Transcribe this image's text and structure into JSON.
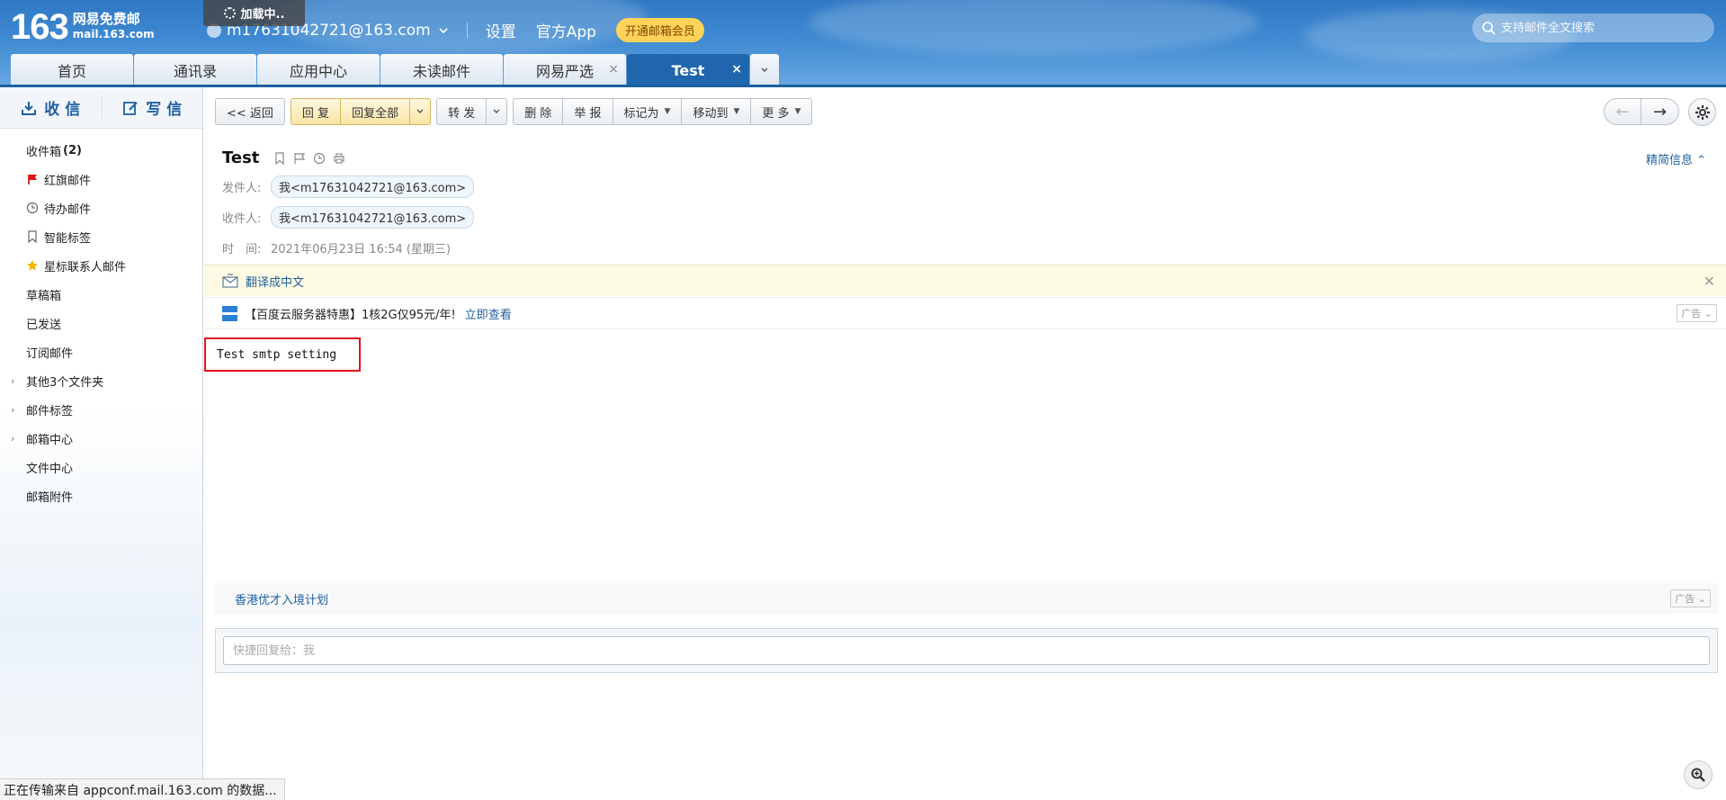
{
  "header": {
    "logo_number": "163",
    "logo_name": "网易免费邮",
    "logo_domain": "mail.163.com",
    "loading_text": "加载中..",
    "account": "m17631042721@163.com",
    "settings_label": "设置",
    "app_label": "官方App",
    "vip_label": "开通邮箱会员",
    "search_placeholder": "支持邮件全文搜索"
  },
  "tabs": [
    {
      "label": "首页"
    },
    {
      "label": "通讯录"
    },
    {
      "label": "应用中心"
    },
    {
      "label": "未读邮件"
    },
    {
      "label": "网易严选",
      "close": "×"
    },
    {
      "label": "Test",
      "close": "×",
      "active": true
    }
  ],
  "sidebar": {
    "receive_label": "收 信",
    "compose_label": "写 信",
    "folders": [
      {
        "label": "收件箱",
        "count": "(2)"
      },
      {
        "label": "红旗邮件",
        "icon": "red-flag-icon"
      },
      {
        "label": "待办邮件",
        "icon": "clock-icon"
      },
      {
        "label": "智能标签",
        "icon": "bookmark-icon"
      },
      {
        "label": "星标联系人邮件",
        "icon": "star-icon"
      },
      {
        "label": "草稿箱"
      },
      {
        "label": "已发送"
      },
      {
        "label": "订阅邮件"
      },
      {
        "label": "其他3个文件夹",
        "expand": "›"
      },
      {
        "label": "邮件标签",
        "expand": "›"
      },
      {
        "label": "邮箱中心",
        "expand": "›"
      },
      {
        "label": "文件中心"
      },
      {
        "label": "邮箱附件"
      }
    ]
  },
  "toolbar": {
    "back": "<< 返回",
    "reply": "回 复",
    "reply_all": "回复全部",
    "forward": "转 发",
    "delete": "删 除",
    "report": "举 报",
    "mark_as": "标记为",
    "move_to": "移动到",
    "more": "更 多"
  },
  "mail": {
    "subject": "Test",
    "brief_info": "精简信息",
    "sender_label": "发件人:",
    "sender": "我<m17631042721@163.com>",
    "recipient_label": "收件人:",
    "recipient": "我<m17631042721@163.com>",
    "time_label": "时　间:",
    "time": "2021年06月23日 16:54 (星期三)",
    "translate": "翻译成中文",
    "ad_text": "【百度云服务器特惠】1核2G仅95元/年!",
    "ad_link": "立即查看",
    "ad_tag": "广告",
    "body": "Test smtp setting",
    "promo_text": "香港优才入境计划",
    "promo_tag": "广告",
    "quick_reply_placeholder": "快捷回复给：我"
  },
  "status_bar": "正在传输来自 appconf.mail.163.com 的数据..."
}
